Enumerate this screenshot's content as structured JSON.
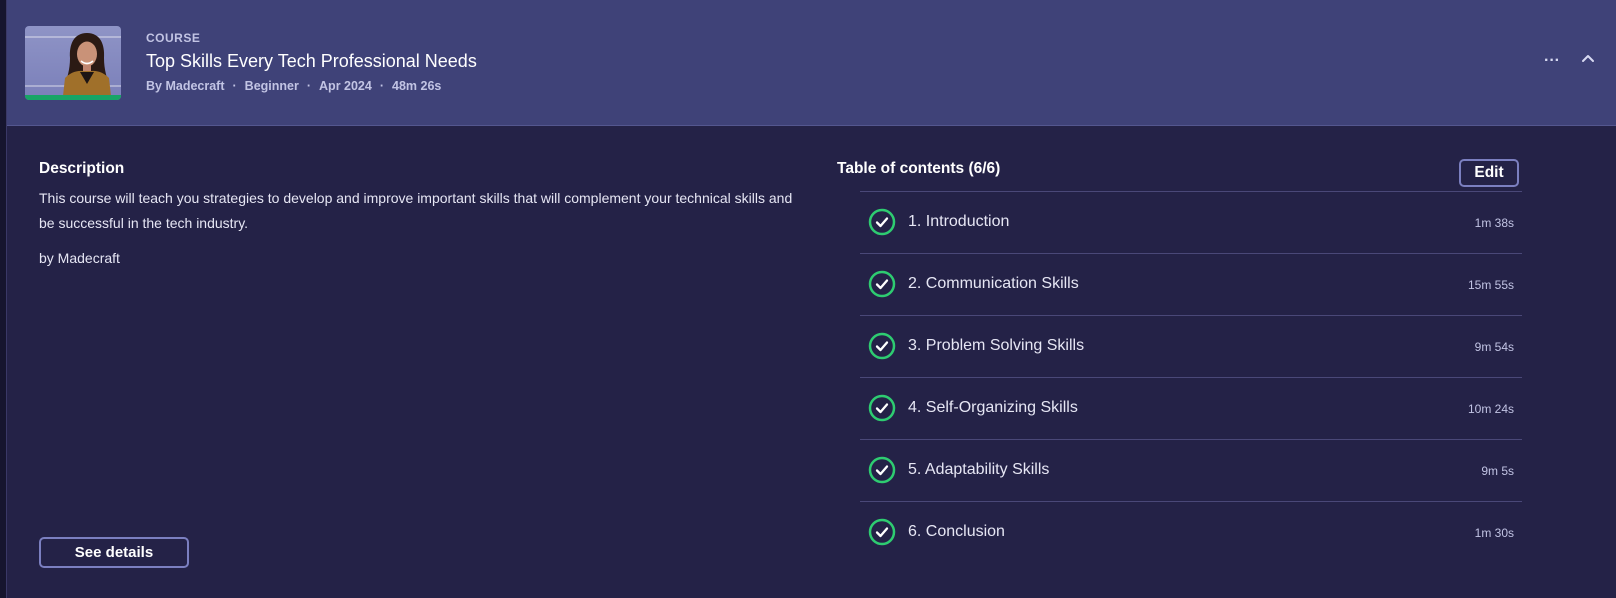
{
  "course": {
    "kicker": "COURSE",
    "title": "Top Skills Every Tech Professional Needs",
    "author": "By Madecraft",
    "level": "Beginner",
    "date": "Apr 2024",
    "duration": "48m 26s",
    "progress": 1.0,
    "more_icon": "more-horizontal-icon",
    "collapse_icon": "chevron-up-icon"
  },
  "description": {
    "heading": "Description",
    "text": "This course will teach you strategies to develop and improve important skills that will complement your technical skills and be successful in the tech industry.",
    "byline": "by Madecraft",
    "details_label": "See details"
  },
  "toc": {
    "heading": "Table of contents (6/6)",
    "edit_label": "Edit",
    "items": [
      {
        "label": "1. Introduction",
        "duration": "1m 38s",
        "completed": true
      },
      {
        "label": "2. Communication Skills",
        "duration": "15m 55s",
        "completed": true
      },
      {
        "label": "3. Problem Solving Skills",
        "duration": "9m 54s",
        "completed": true
      },
      {
        "label": "4. Self-Organizing Skills",
        "duration": "10m 24s",
        "completed": true
      },
      {
        "label": "5. Adaptability Skills",
        "duration": "9m 5s",
        "completed": true
      },
      {
        "label": "6. Conclusion",
        "duration": "1m 30s",
        "completed": true
      }
    ]
  },
  "colors": {
    "accent_green": "#2ecc71",
    "header_bg": "#3f4278",
    "body_bg": "#242247"
  }
}
